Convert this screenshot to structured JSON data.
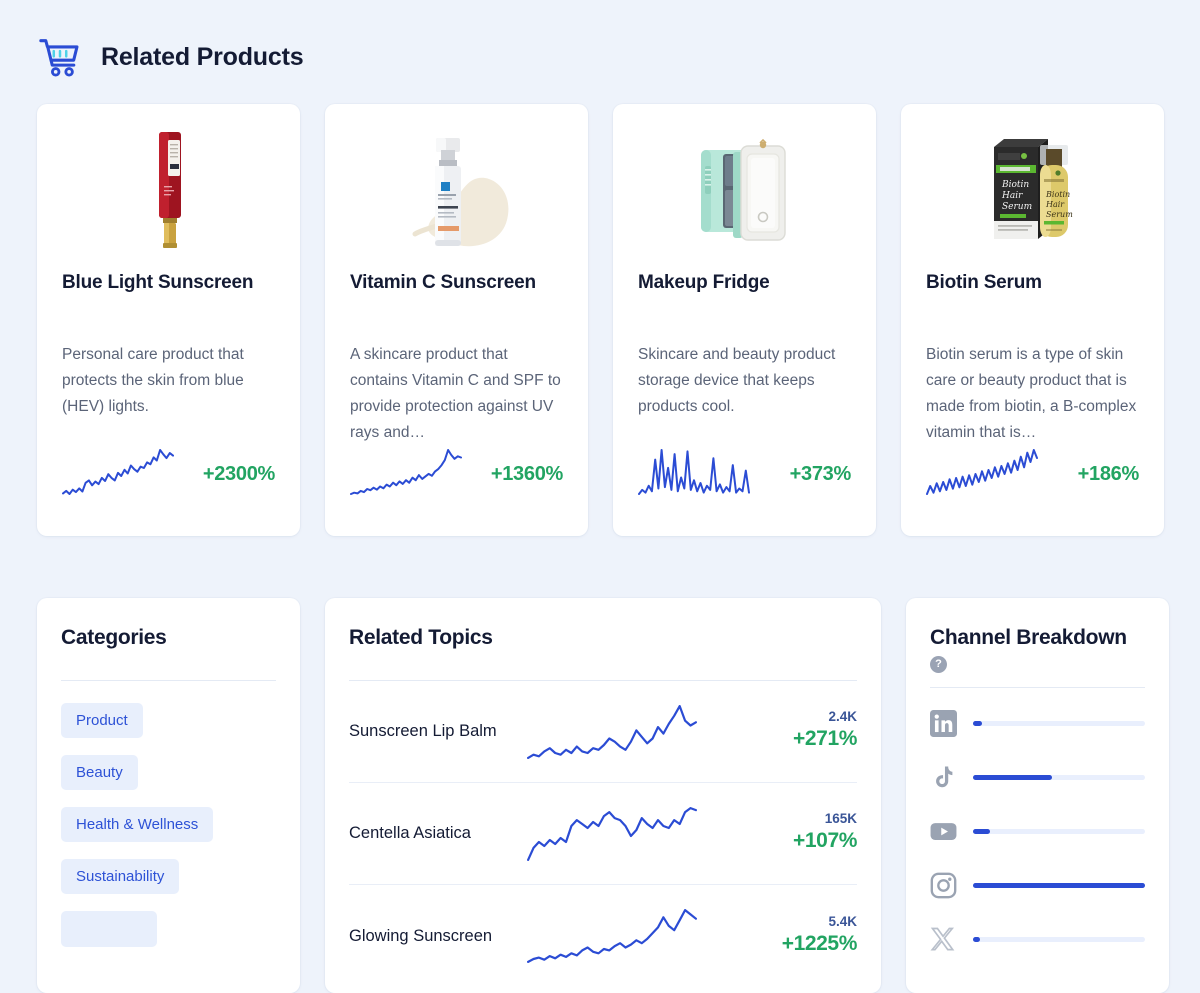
{
  "header": {
    "title": "Related Products",
    "icon": "shopping-cart-icon"
  },
  "colors": {
    "background": "#eef3fb",
    "card": "#ffffff",
    "title": "#141b34",
    "body_text": "#5b6478",
    "growth_green": "#22a462",
    "spark_blue": "#2b4cd4",
    "chip_bg": "#e8effc",
    "chip_text": "#2d52d6",
    "bar_track": "#e9effd"
  },
  "products": [
    {
      "name": "Blue Light Sunscreen",
      "description": "Personal care product that protects the skin from blue (HEV) lights.",
      "growth": "+2300%",
      "image": "red-sunscreen-tube-image",
      "sparkline": [
        5,
        9,
        4,
        11,
        7,
        13,
        8,
        22,
        26,
        18,
        24,
        20,
        30,
        25,
        36,
        30,
        26,
        38,
        33,
        43,
        37,
        50,
        44,
        40,
        48,
        46,
        55,
        52,
        63,
        58,
        75,
        68,
        62,
        70,
        66
      ]
    },
    {
      "name": "Vitamin C Sunscreen",
      "description": "A skincare product that contains Vitamin C and SPF to provide protection against UV rays and…",
      "growth": "+1360%",
      "image": "vitamin-c-serum-pump-bottle-image",
      "sparkline": [
        4,
        6,
        5,
        9,
        7,
        12,
        10,
        14,
        11,
        16,
        13,
        19,
        16,
        22,
        18,
        24,
        20,
        26,
        22,
        30,
        26,
        34,
        28,
        32,
        36,
        33,
        40,
        44,
        50,
        58,
        74,
        66,
        60,
        64,
        62
      ]
    },
    {
      "name": "Makeup Fridge",
      "description": "Skincare and beauty product storage device that keeps products cool.",
      "growth": "+373%",
      "image": "mint-makeup-fridge-image",
      "sparkline": [
        6,
        12,
        8,
        18,
        10,
        56,
        14,
        70,
        16,
        44,
        12,
        64,
        10,
        30,
        14,
        68,
        12,
        26,
        10,
        22,
        8,
        18,
        12,
        58,
        10,
        20,
        8,
        16,
        10,
        48,
        8,
        14,
        10,
        40,
        8
      ]
    },
    {
      "name": "Biotin Serum",
      "description": "Biotin serum is a type of skin care or beauty product that is made from biotin, a B-complex vitamin that is…",
      "growth": "+186%",
      "image": "biotin-hair-serum-box-and-bottle-image",
      "sparkline": [
        8,
        20,
        10,
        24,
        12,
        26,
        14,
        30,
        16,
        32,
        18,
        34,
        20,
        36,
        22,
        38,
        26,
        42,
        28,
        44,
        32,
        48,
        34,
        50,
        38,
        54,
        40,
        58,
        44,
        64,
        48,
        70,
        56,
        74,
        62
      ]
    }
  ],
  "categories": {
    "title": "Categories",
    "items": [
      "Product",
      "Beauty",
      "Health & Wellness",
      "Sustainability",
      ""
    ]
  },
  "related_topics": {
    "title": "Related Topics",
    "rows": [
      {
        "name": "Sunscreen Lip Balm",
        "volume": "2.4K",
        "growth": "+271%",
        "sparkline": [
          6,
          10,
          8,
          14,
          18,
          12,
          10,
          16,
          12,
          20,
          14,
          12,
          18,
          16,
          22,
          30,
          26,
          20,
          16,
          26,
          40,
          32,
          24,
          30,
          44,
          36,
          48,
          58,
          70,
          52,
          46,
          50
        ]
      },
      {
        "name": "Centella Asiatica",
        "volume": "165K",
        "growth": "+107%",
        "sparkline": [
          4,
          16,
          22,
          18,
          24,
          20,
          26,
          22,
          38,
          44,
          40,
          36,
          42,
          38,
          48,
          52,
          46,
          44,
          38,
          28,
          34,
          46,
          40,
          36,
          44,
          38,
          36,
          44,
          40,
          52,
          56,
          54
        ]
      },
      {
        "name": "Glowing Sunscreen",
        "volume": "5.4K",
        "growth": "+1225%",
        "sparkline": [
          4,
          8,
          10,
          7,
          12,
          9,
          14,
          11,
          16,
          13,
          20,
          24,
          18,
          16,
          22,
          20,
          26,
          30,
          24,
          28,
          34,
          30,
          36,
          44,
          52,
          66,
          54,
          48,
          62,
          76,
          70,
          64
        ]
      }
    ]
  },
  "channel_breakdown": {
    "title": "Channel Breakdown",
    "help_icon": "help-circle-icon",
    "channels": [
      {
        "name": "LinkedIn",
        "icon": "linkedin-icon",
        "percent": 5
      },
      {
        "name": "TikTok",
        "icon": "tiktok-icon",
        "percent": 46
      },
      {
        "name": "YouTube",
        "icon": "youtube-icon",
        "percent": 10
      },
      {
        "name": "Instagram",
        "icon": "instagram-icon",
        "percent": 100
      },
      {
        "name": "X",
        "icon": "x-twitter-icon",
        "percent": 4
      }
    ]
  }
}
